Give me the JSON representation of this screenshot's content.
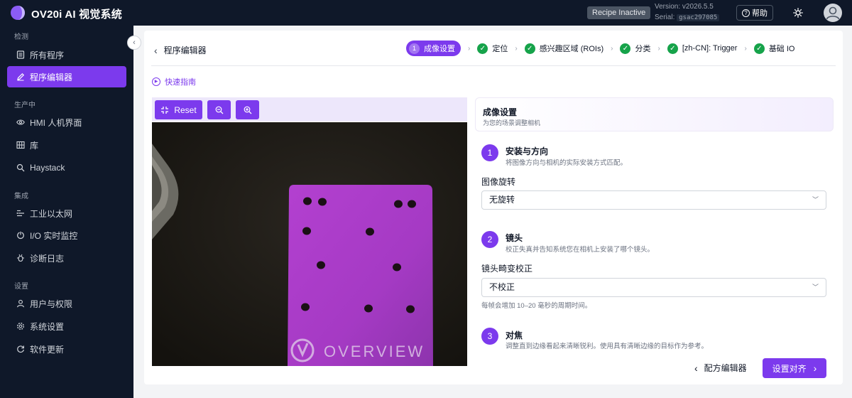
{
  "app": {
    "title": "OV20i AI 视觉系统",
    "recipe_status": "Recipe Inactive",
    "version_text": "Version: v2026.5.5",
    "serial_label": "Serial:",
    "serial_value": "gsac297085",
    "help_label": "帮助",
    "colors": {
      "accent": "#7c3aed",
      "nav_bg": "#0f1829",
      "success": "#16a34a"
    }
  },
  "sidebar": {
    "sections": [
      {
        "title": "检测",
        "items": [
          {
            "label": "所有程序",
            "icon": "list-icon"
          },
          {
            "label": "程序编辑器",
            "icon": "edit-icon",
            "active": true
          }
        ]
      },
      {
        "title": "生产中",
        "items": [
          {
            "label": "HMI 人机界面",
            "icon": "eye-icon"
          },
          {
            "label": "库",
            "icon": "grid-icon"
          },
          {
            "label": "Haystack",
            "icon": "search-icon"
          }
        ]
      },
      {
        "title": "集成",
        "items": [
          {
            "label": "工业以太网",
            "icon": "network-icon"
          },
          {
            "label": "I/O 实时监控",
            "icon": "io-icon"
          },
          {
            "label": "诊断日志",
            "icon": "bug-icon"
          }
        ]
      },
      {
        "title": "设置",
        "items": [
          {
            "label": "用户与权限",
            "icon": "user-icon"
          },
          {
            "label": "系统设置",
            "icon": "gear-icon"
          },
          {
            "label": "软件更新",
            "icon": "refresh-icon"
          }
        ]
      }
    ]
  },
  "editor": {
    "back_label": "程序编辑器",
    "quick_guide": "快速指南",
    "steps": [
      {
        "num": "1",
        "label": "成像设置",
        "state": "active"
      },
      {
        "label": "定位",
        "state": "done"
      },
      {
        "label": "感兴趣区域 (ROIs)",
        "state": "done"
      },
      {
        "label": "分类",
        "state": "done"
      },
      {
        "label": "[zh-CN]: Trigger",
        "state": "done"
      },
      {
        "label": "基础 IO",
        "state": "done"
      }
    ]
  },
  "viewer": {
    "reset_label": "Reset",
    "zoom_out_icon": "zoom-out-icon",
    "zoom_in_icon": "zoom-in-icon",
    "plate_text": "OVERVIEW"
  },
  "panel": {
    "title": "成像设置",
    "subtitle": "为您的场景调整相机",
    "sections": [
      {
        "num": "1",
        "title": "安装与方向",
        "desc": "将图像方向与相机的实际安装方式匹配。",
        "field_label": "图像旋转",
        "value": "无旋转"
      },
      {
        "num": "2",
        "title": "镜头",
        "desc": "校正失真并告知系统您在相机上安装了哪个镜头。",
        "field_label": "镜头畸变校正",
        "value": "不校正",
        "hint": "每帧会增加 10–20 毫秒的周期时间。"
      },
      {
        "num": "3",
        "title": "对焦",
        "desc": "调整直到边缘看起来清晰锐利。使用具有清晰边缘的目标作为参考。"
      }
    ],
    "back_button": "配方编辑器",
    "next_button": "设置对齐"
  }
}
